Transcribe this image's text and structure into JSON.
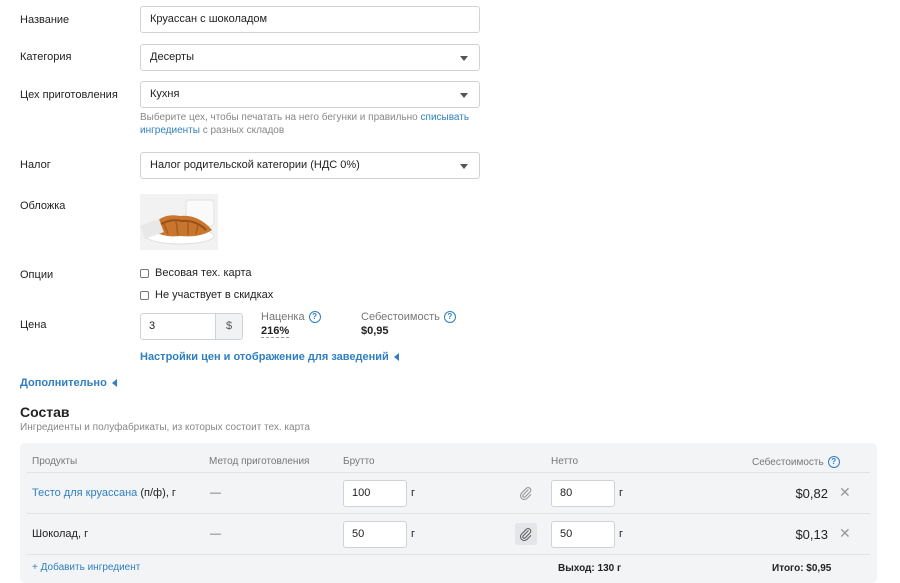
{
  "form": {
    "name_label": "Название",
    "name_value": "Круассан с шоколадом",
    "category_label": "Категория",
    "category_value": "Десерты",
    "workshop_label": "Цех приготовления",
    "workshop_value": "Кухня",
    "workshop_hint_1": "Выберите цех, чтобы печатать на него бегунки и правильно ",
    "workshop_hint_link": "списывать ингредиенты",
    "workshop_hint_2": " с разных складов",
    "tax_label": "Налог",
    "tax_value": "Налог родительской категории (НДС 0%)",
    "cover_label": "Обложка",
    "options_label": "Опции",
    "option_weight": "Весовая тех. карта",
    "option_discount": "Не участвует в скидках",
    "price_label": "Цена",
    "price_value": "3",
    "currency": "$",
    "markup_label": "Наценка",
    "markup_value": "216%",
    "cost_label": "Себестоимость",
    "cost_value": "$0,95",
    "price_settings_link": "Настройки цен и отображение для заведений",
    "more_link": "Дополнительно"
  },
  "composition": {
    "title": "Состав",
    "subtitle": "Ингредиенты и полуфабрикаты, из которых состоит тех. карта",
    "headers": {
      "products": "Продукты",
      "method": "Метод приготовления",
      "gross": "Брутто",
      "net": "Нетто",
      "cost": "Себестоимость"
    },
    "rows": [
      {
        "product_link": "Тесто для круассана",
        "product_suffix": " (п/ф), г",
        "method": "—",
        "gross": "100",
        "gross_unit": "г",
        "net": "80",
        "net_unit": "г",
        "cost": "$0,82"
      },
      {
        "product_link": "",
        "product_suffix": "Шоколад, г",
        "method": "—",
        "gross": "50",
        "gross_unit": "г",
        "net": "50",
        "net_unit": "г",
        "cost": "$0,13"
      }
    ],
    "add_ingredient": "+ Добавить ингредиент",
    "yield": "Выход: 130 г",
    "total": "Итого: $0,95"
  },
  "icons": {
    "caret": "chevron-down-icon",
    "help": "question-icon",
    "attach": "paperclip-icon",
    "remove": "close-icon"
  },
  "colors": {
    "link": "#2f7fc1",
    "table_bg": "#f3f4f6"
  }
}
